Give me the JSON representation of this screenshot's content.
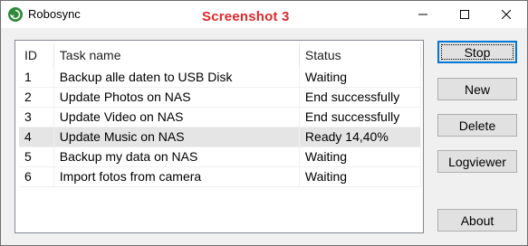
{
  "window": {
    "title": "Robosync",
    "overlay_label": "Screenshot 3",
    "icon": "robosync-app-icon"
  },
  "window_controls": {
    "minimize_icon": "minimize-icon",
    "maximize_icon": "maximize-icon",
    "close_icon": "close-icon"
  },
  "tasks": {
    "columns": [
      "ID",
      "Task name",
      "Status"
    ],
    "rows": [
      {
        "id": "1",
        "name": "Backup alle daten to USB Disk",
        "status": "Waiting"
      },
      {
        "id": "2",
        "name": "Update Photos on NAS",
        "status": "End successfully"
      },
      {
        "id": "3",
        "name": "Update Video on NAS",
        "status": "End successfully"
      },
      {
        "id": "4",
        "name": "Update Music on NAS",
        "status": "Ready 14,40%",
        "selected": true
      },
      {
        "id": "5",
        "name": "Backup my data on NAS",
        "status": "Waiting"
      },
      {
        "id": "6",
        "name": "Import fotos from camera",
        "status": "Waiting"
      }
    ]
  },
  "buttons": {
    "stop": "Stop",
    "new": "New",
    "delete": "Delete",
    "logviewer": "Logviewer",
    "about": "About"
  },
  "colors": {
    "overlay": "#e0282c",
    "accent": "#0078d7",
    "selected_row": "#e5e5e5"
  }
}
